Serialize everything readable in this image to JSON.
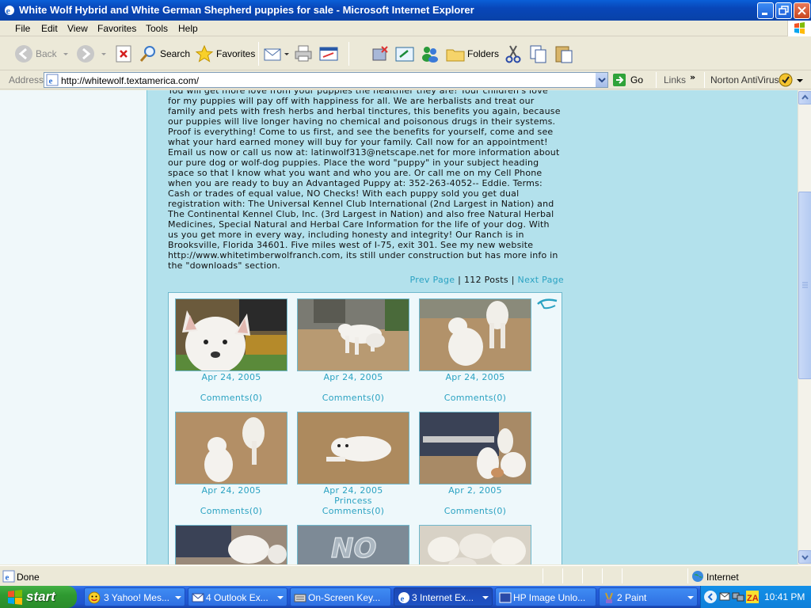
{
  "window": {
    "title": "White Wolf Hybrid and White German Shepherd puppies for sale - Microsoft Internet Explorer"
  },
  "menu": [
    "File",
    "Edit",
    "View",
    "Favorites",
    "Tools",
    "Help"
  ],
  "toolbar": {
    "back": "Back",
    "search": "Search",
    "favorites": "Favorites",
    "folders": "Folders"
  },
  "address": {
    "label": "Address",
    "url": "http://whitewolf.textamerica.com/",
    "go": "Go",
    "links": "Links",
    "norton": "Norton AntiVirus"
  },
  "page": {
    "body_lines": [
      "You will get more love from your puppies the healthier they are! Your children's love",
      "for my puppies will pay off with happiness for all. We are herbalists and treat our",
      "family and pets with fresh herbs and herbal tinctures, this benefits you again, because",
      "our puppies will live longer having no chemical and poisonous drugs in their systems.",
      "Proof is everything! Come to us first, and see the benefits for yourself, come and see",
      "what your hard earned money will buy for your family. Call now for an appointment!",
      "Email us now or call us now at: latinwolf313@netscape.net for more information about",
      "our pure dog or wolf-dog puppies. Place the word \"puppy\" in your subject heading",
      "space so that I know what you want and who you are. Or call me on my Cell Phone",
      "when you are ready to buy an Advantaged Puppy at: 352-263-4052-- Eddie. Terms:",
      "Cash or trades of equal value, NO Checks! With each puppy sold you get dual",
      "registration with: The Universal Kennel Club International (2nd Largest in Nation) and",
      "The Continental Kennel Club, Inc. (3rd Largest in Nation) and also free Natural Herbal",
      "Medicines, Special Natural and Herbal Care Information for the life of your dog. With",
      "us you get more in every way, including honesty and integrity! Our Ranch is in",
      "Brooksville, Florida 34601. Five miles west of I-75, exit 301. See my new website",
      "http://www.whitetimberwolfranch.com, its still under construction but has more info in",
      "the \"downloads\" section."
    ],
    "pager": {
      "prev": "Prev Page",
      "sep": "|",
      "count": "112 Posts",
      "next": "Next Page"
    },
    "posts": [
      {
        "date": "Apr 24, 2005",
        "title": "",
        "comments": "Comments(0)"
      },
      {
        "date": "Apr 24, 2005",
        "title": "",
        "comments": "Comments(0)"
      },
      {
        "date": "Apr 24, 2005",
        "title": "",
        "comments": "Comments(0)"
      },
      {
        "date": "Apr 24, 2005",
        "title": "",
        "comments": "Comments(0)"
      },
      {
        "date": "Apr 24, 2005",
        "title": "Princess",
        "comments": "Comments(0)"
      },
      {
        "date": "Apr 2, 2005",
        "title": "",
        "comments": "Comments(0)"
      }
    ],
    "no_image_text": "NO"
  },
  "status": {
    "text": "Done",
    "zone": "Internet"
  },
  "taskbar": {
    "start": "start",
    "tasks": [
      "3 Yahoo! Mes...",
      "4 Outlook Ex...",
      "On-Screen Key...",
      "3 Internet Ex...",
      "HP Image Unlo...",
      "2 Paint"
    ],
    "clock": "10:41 PM"
  },
  "colors": {
    "page_bg": "#b3e1ec",
    "link": "#2aa2c2",
    "xp_blue": "#245edb",
    "start_green": "#2f9a31"
  }
}
